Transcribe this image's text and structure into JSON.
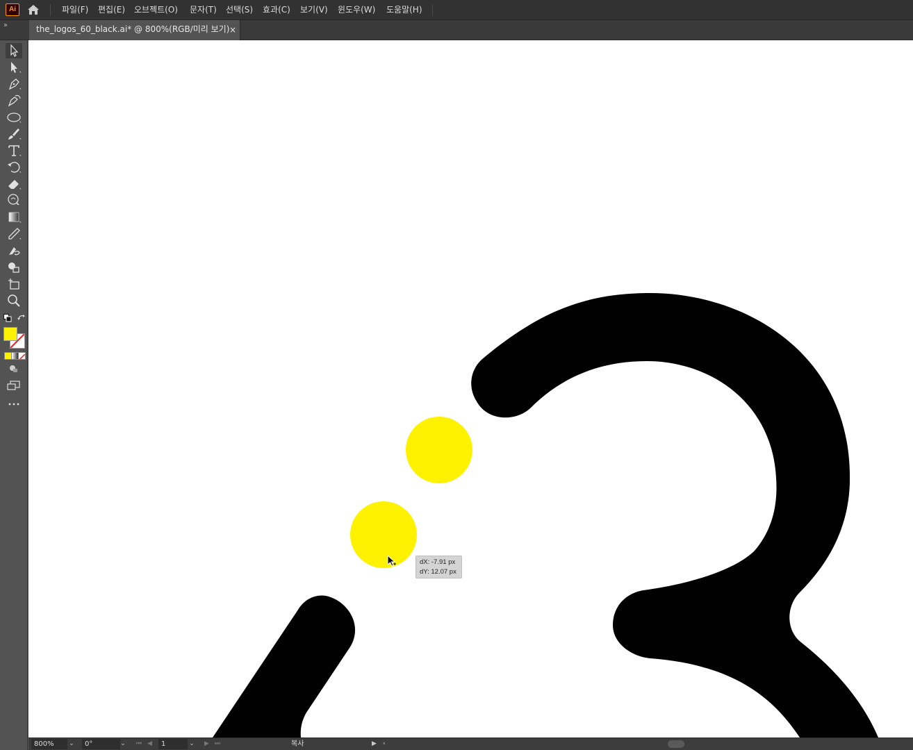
{
  "app": {
    "logo_text": "Ai"
  },
  "menu": {
    "items": [
      "파일(F)",
      "편집(E)",
      "오브젝트(O)",
      "문자(T)",
      "선택(S)",
      "효과(C)",
      "보기(V)",
      "윈도우(W)",
      "도움말(H)"
    ]
  },
  "document": {
    "tab_title": "the_logos_60_black.ai*  @  800%(RGB/미리 보기)",
    "close_glyph": "×"
  },
  "tools": [
    {
      "name": "selection-tool-icon",
      "selected": true
    },
    {
      "name": "direct-selection-tool-icon"
    },
    {
      "name": "pen-tool-icon"
    },
    {
      "name": "curvature-tool-icon"
    },
    {
      "name": "ellipse-tool-icon"
    },
    {
      "name": "paintbrush-tool-icon"
    },
    {
      "name": "type-tool-icon"
    },
    {
      "name": "rotate-tool-icon"
    },
    {
      "name": "eraser-tool-icon"
    },
    {
      "name": "puppet-warp-tool-icon"
    },
    {
      "name": "gradient-tool-icon"
    },
    {
      "name": "eyedropper-tool-icon"
    },
    {
      "name": "blend-tool-icon"
    },
    {
      "name": "shape-builder-tool-icon"
    },
    {
      "name": "artboard-tool-icon"
    },
    {
      "name": "zoom-tool-icon"
    }
  ],
  "colors": {
    "fill": "#fff200",
    "artwork_black": "#000000",
    "canvas": "#ffffff"
  },
  "tooltip": {
    "dx": "dX: -7.91 px",
    "dy": "dY: 12.07 px"
  },
  "statusbar": {
    "zoom": "800%",
    "rotation": "0°",
    "artboard": "1",
    "status_label": "복사"
  }
}
